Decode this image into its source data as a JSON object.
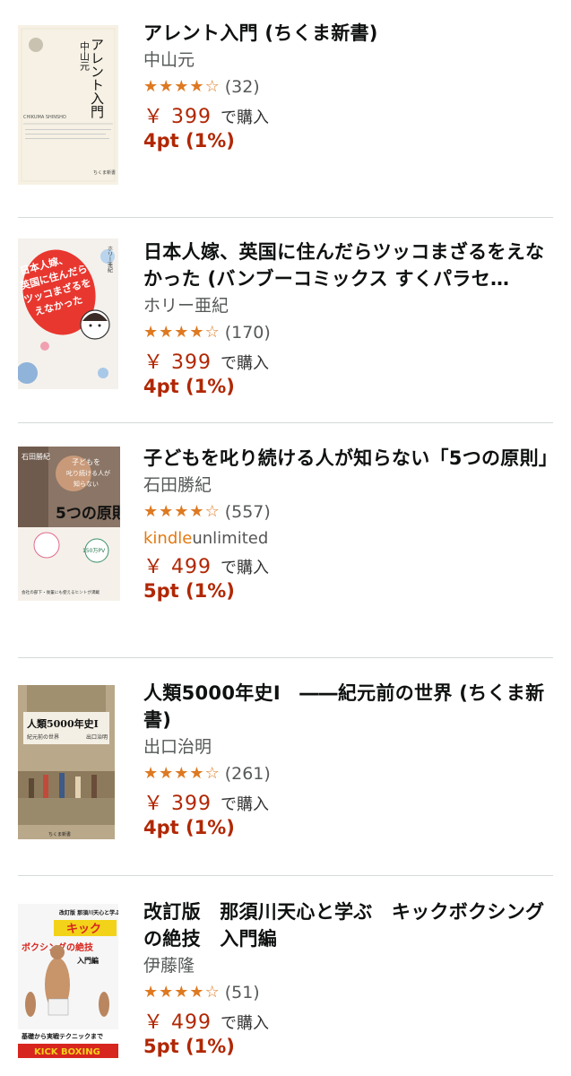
{
  "results": [
    {
      "title": "アレント入門 (ちくま新書)",
      "author": "中山元",
      "stars": [
        "full",
        "full",
        "full",
        "full",
        "empty"
      ],
      "rating_count": "(32)",
      "price": "￥ 399",
      "buy_label": "で購入",
      "points": "4pt (1%)",
      "cover": {
        "vertical_title": "アレント入門",
        "author": "中山元",
        "publisher_en": "CHIKUMA SHINSHO",
        "publisher": "ちくま新書"
      }
    },
    {
      "title": "日本人嫁、英国に住んだらツッコまざるをえなかった (バンブーコミックス すくパラセ…",
      "author": "ホリー亜紀",
      "stars": [
        "full",
        "full",
        "full",
        "full",
        "empty"
      ],
      "rating_count": "(170)",
      "price": "￥ 399",
      "buy_label": "で購入",
      "points": "4pt (1%)",
      "cover": {
        "title_lines": [
          "日本人嫁、",
          "英国に住んだら",
          "ツッコまざるを",
          "えなかった"
        ],
        "author": "ホリー亜紀"
      }
    },
    {
      "title": "子どもを叱り続ける人が知らない「5つの原則」",
      "author": "石田勝紀",
      "stars": [
        "full",
        "full",
        "full",
        "full",
        "empty"
      ],
      "rating_count": "(557)",
      "kindle_unlimited": {
        "kindle": "kindle",
        "unlimited": "unlimited"
      },
      "price": "￥ 499",
      "buy_label": "で購入",
      "points": "5pt (1%)",
      "cover": {
        "author": "石田勝紀",
        "line1": "子どもを",
        "line2": "叱り続ける人が",
        "line3": "知らない",
        "big": "5つの原則",
        "badge": "150万PV",
        "footer": "会社の部下・後輩にも使えるヒントが満載"
      }
    },
    {
      "title": "人類5000年史Ⅰ　――紀元前の世界 (ちくま新書)",
      "author": "出口治明",
      "stars": [
        "full",
        "full",
        "full",
        "full",
        "empty"
      ],
      "rating_count": "(261)",
      "price": "￥ 399",
      "buy_label": "で購入",
      "points": "4pt (1%)",
      "cover": {
        "title": "人類5000年史Ⅰ",
        "subtitle": "紀元前の世界",
        "author": "出口治明",
        "publisher": "ちくま新書"
      }
    },
    {
      "title": "改訂版　那須川天心と学ぶ　キックボクシングの絶技　入門編",
      "author": "伊藤隆",
      "stars": [
        "full",
        "full",
        "full",
        "full",
        "empty"
      ],
      "rating_count": "(51)",
      "price": "￥ 499",
      "buy_label": "で購入",
      "points": "5pt (1%)",
      "cover": {
        "top": "改訂版 那須川天心と学ぶ",
        "big1": "キック",
        "big2": "ボクシングの絶技",
        "sub": "入門編",
        "footer": "基礎から実戦テクニックまで",
        "banner": "KICK BOXING"
      }
    }
  ],
  "colors": {
    "price": "#b12704",
    "star": "#de7921",
    "author": "#565959",
    "divider": "#d5d9d9",
    "kindle": "#e47911"
  }
}
